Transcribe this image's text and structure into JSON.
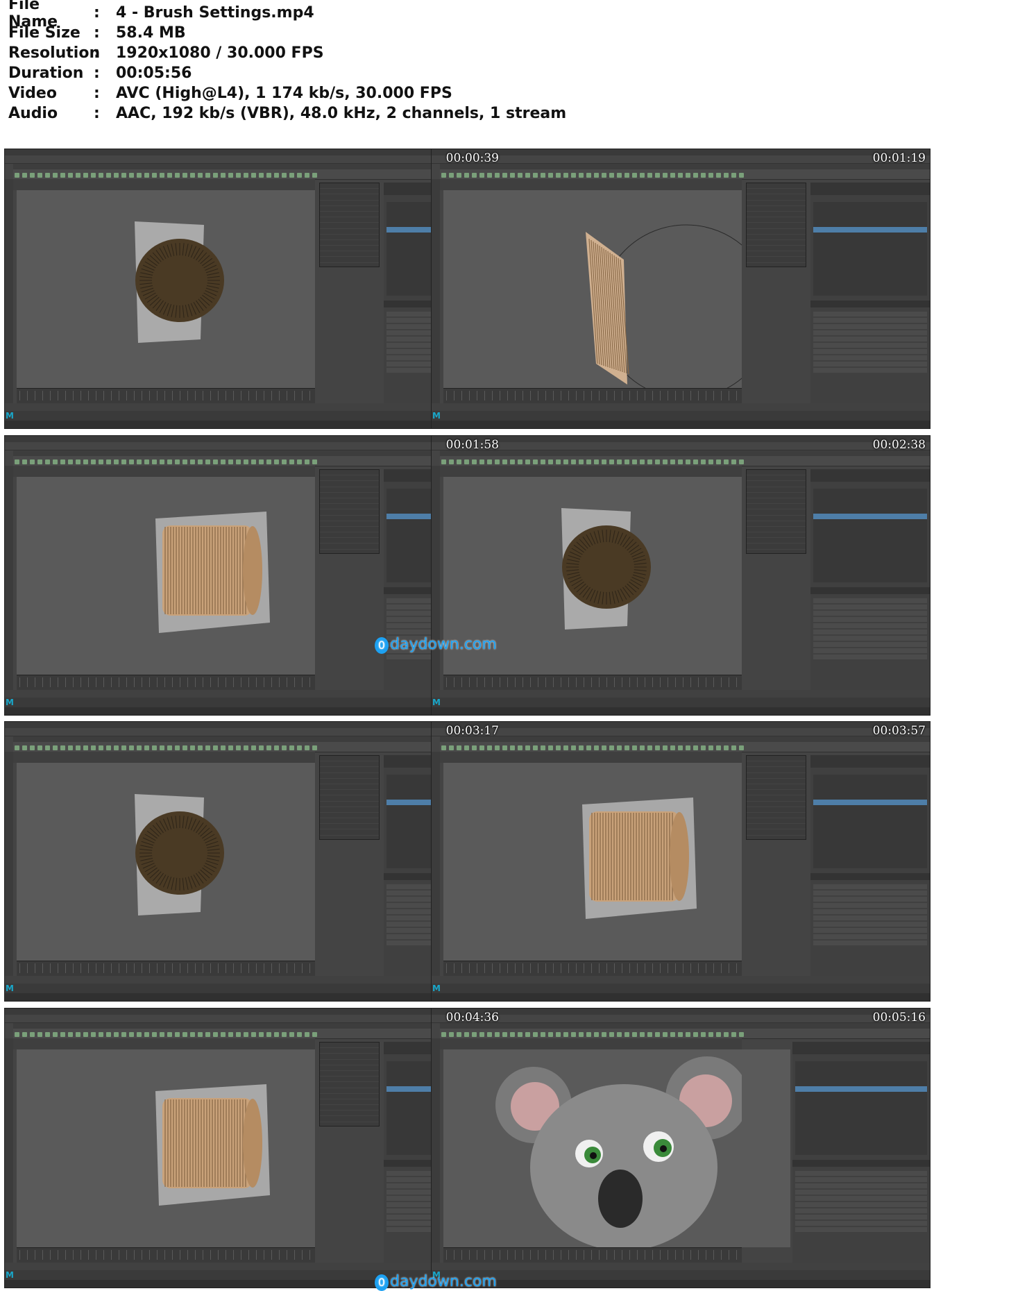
{
  "info": [
    {
      "key": "File Name",
      "value": "4 - Brush Settings.mp4"
    },
    {
      "key": "File Size",
      "value": "58.4 MB"
    },
    {
      "key": "Resolution",
      "value": "1920x1080 / 30.000 FPS"
    },
    {
      "key": "Duration",
      "value": "00:05:56"
    },
    {
      "key": "Video",
      "value": "AVC (High@L4), 1 174 kb/s, 30.000 FPS"
    },
    {
      "key": "Audio",
      "value": "AAC, 192 kb/s (VBR), 48.0 kHz, 2 channels, 1 stream"
    }
  ],
  "separator": ":",
  "thumbnails": [
    {
      "timestamp": "00:00:39",
      "subject": "furball"
    },
    {
      "timestamp": "00:01:19",
      "subject": "slanted-strands"
    },
    {
      "timestamp": "00:01:58",
      "subject": "cylinder"
    },
    {
      "timestamp": "00:02:38",
      "subject": "furball"
    },
    {
      "timestamp": "00:03:17",
      "subject": "furball"
    },
    {
      "timestamp": "00:03:57",
      "subject": "cylinder"
    },
    {
      "timestamp": "00:04:36",
      "subject": "cylinder"
    },
    {
      "timestamp": "00:05:16",
      "subject": "koala"
    }
  ],
  "watermark": {
    "text": "daydown.com",
    "badge": "0"
  },
  "colors": {
    "maya_bg": "#444444",
    "viewport": "#5a5a5a",
    "selection": "#4e7ea8",
    "fur_dark": "#4a3a24",
    "fur_light": "#c9a27a",
    "timestamp": "#ffffff",
    "watermark": "#1da1f2"
  }
}
